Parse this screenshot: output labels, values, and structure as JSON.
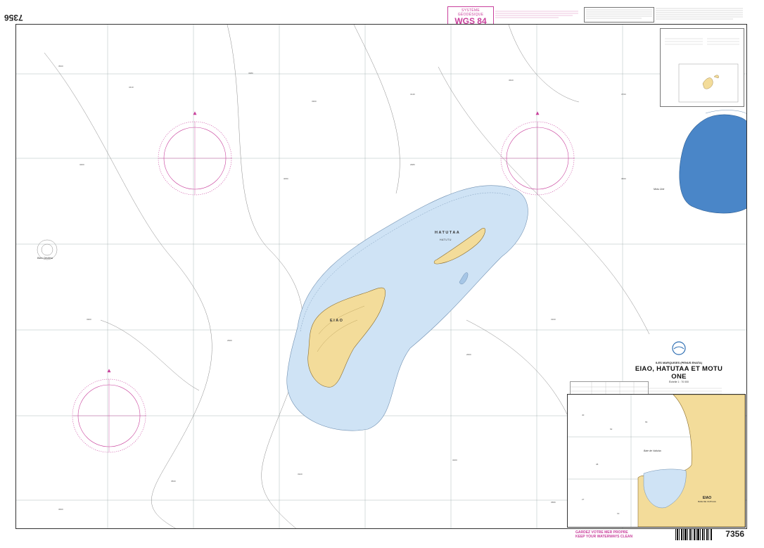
{
  "chart_number": "7356",
  "geodetic": {
    "system_label": "SYSTÈME GÉODÉSIQUE",
    "datum": "WGS 84"
  },
  "title": {
    "region": "ILES MARQUISES (PENUS ENATA)",
    "name": "EIAO, HATUTAA ET MOTU ONE",
    "scale": "Échelle 1 : 70 000"
  },
  "publisher": "SHOM",
  "places": {
    "hatutaa": "HATUTAA",
    "hatutu": "HATUTU",
    "eiao": "EIAO",
    "banc": "Banc Dindiera",
    "motu_one": "Motu One"
  },
  "inset": {
    "name": "EIAO",
    "subtitle": "BAIE DE VAITUHA",
    "bay_label": "Baie de Vaituha"
  },
  "clean_water": {
    "fr": "GARDEZ VOTRE MER PROPRE",
    "en": "KEEP YOUR WATERWAYS CLEAN"
  },
  "colors": {
    "land": "#f3dc9a",
    "shallow": "#cfe3f5",
    "deep_inset": "#4a86c8",
    "magenta": "#c9409c",
    "frame": "#333333"
  },
  "longitudes": [
    "141°10'",
    "141°10'",
    "140°50'"
  ],
  "icons": [
    "shom-logo",
    "compass-rose",
    "barcode"
  ]
}
